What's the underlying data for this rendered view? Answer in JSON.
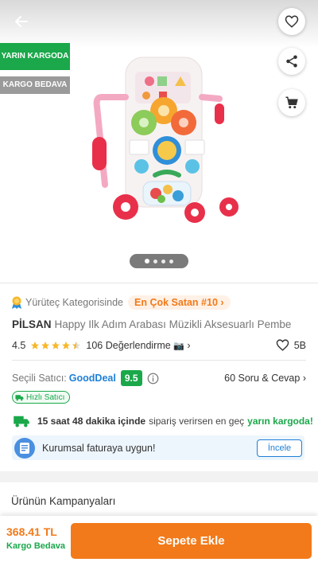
{
  "badges": {
    "delivery": "YARIN KARGODA",
    "free_shipping": "KARGO BEDAVA"
  },
  "gallery": {
    "image_count": 4,
    "active_index": 0
  },
  "ranking": {
    "text": "Yürüteç Kategorisinde",
    "badge": "En Çok Satan #10",
    "chevron": "›"
  },
  "product": {
    "brand": "PİLSAN",
    "name": "Happy Ilk Adım Arabası Müzikli Aksesuarlı Pembe",
    "rating": "4.5",
    "rating_value": 4.5,
    "reviews": "106 Değerlendirme",
    "favorites": "5B"
  },
  "seller": {
    "label": "Seçili Satıcı:",
    "name": "GoodDeal",
    "score": "9.5",
    "qa": "60 Soru & Cevap",
    "fast_badge": "Hızlı Satıcı"
  },
  "shipping": {
    "bold": "15 saat 48 dakika içinde",
    "normal": "sipariş verirsen en geç",
    "green": "yarın kargoda!"
  },
  "invoice": {
    "text": "Kurumsal faturaya uygun!",
    "button": "İncele"
  },
  "campaigns": {
    "title": "Ürünün Kampanyaları"
  },
  "footer": {
    "price": "368.41 TL",
    "free_shipping": "Kargo Bedava",
    "add_to_cart": "Sepete Ekle"
  },
  "colors": {
    "orange": "#f27a1a",
    "green": "#1aa84a",
    "blue": "#1e7fd6"
  },
  "icons": [
    "back-arrow-icon",
    "heart-icon",
    "share-icon",
    "cart-icon",
    "medal-icon",
    "star-icon",
    "camera-icon",
    "info-icon",
    "truck-icon",
    "invoice-icon"
  ]
}
